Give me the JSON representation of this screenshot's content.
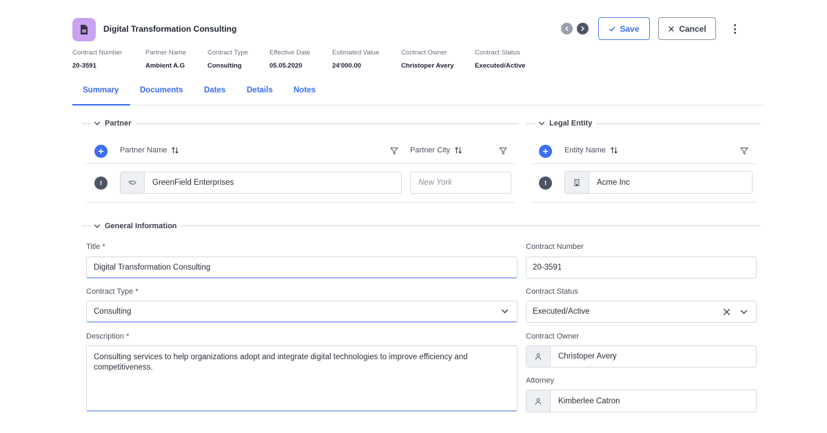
{
  "header": {
    "title": "Digital Transformation Consulting",
    "app_icon": "pdf-document-icon",
    "icon_color": "#c9a3f0",
    "actions": {
      "save_label": "Save",
      "cancel_label": "Cancel"
    }
  },
  "meta": [
    {
      "label": "Contract Number",
      "value": "20-3591"
    },
    {
      "label": "Partner Name",
      "value": "Ambient A.G"
    },
    {
      "label": "Contract Type",
      "value": "Consulting"
    },
    {
      "label": "Effective Date",
      "value": "05.05.2020"
    },
    {
      "label": "Estimated Value",
      "value": "24'000.00"
    },
    {
      "label": "Contract Owner",
      "value": "Christoper Avery"
    },
    {
      "label": "Contract Status",
      "value": "Executed/Active"
    }
  ],
  "tabs": [
    {
      "label": "Summary",
      "active": true
    },
    {
      "label": "Documents"
    },
    {
      "label": "Dates"
    },
    {
      "label": "Details"
    },
    {
      "label": "Notes"
    }
  ],
  "partner": {
    "section_title": "Partner",
    "columns": {
      "name": "Partner Name",
      "city": "Partner City"
    },
    "row": {
      "name": "GreenField Enterprises",
      "city_placeholder": "New York"
    }
  },
  "legal_entity": {
    "section_title": "Legal Entity",
    "columns": {
      "name": "Entity Name"
    },
    "row": {
      "name": "Acme Inc"
    }
  },
  "general": {
    "section_title": "General Information",
    "title_label": "Title *",
    "title_value": "Digital Transformation Consulting",
    "contract_type_label": "Contract Type *",
    "contract_type_value": "Consulting",
    "description_label": "Description *",
    "description_value": "Consulting services to help organizations adopt and integrate digital technologies to improve efficiency and competitiveness.",
    "contract_number_label": "Contract Number",
    "contract_number_value": "20-3591",
    "contract_status_label": "Contract Status",
    "contract_status_value": "Executed/Active",
    "contract_owner_label": "Contract Owner",
    "contract_owner_value": "Christoper Avery",
    "attorney_label": "Attorney",
    "attorney_value": "Kimberlee Catron"
  },
  "colors": {
    "accent": "#3c6df0",
    "focus_underline": "#9fb3f2",
    "dark_button": "#4d5564"
  }
}
